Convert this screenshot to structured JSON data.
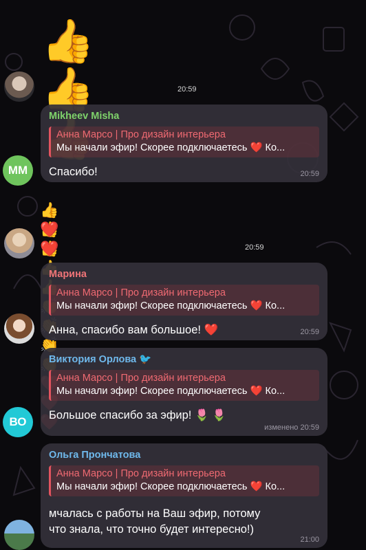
{
  "messages": [
    {
      "type": "emoji",
      "emoji": "👍👍👍",
      "time": "20:59"
    },
    {
      "sender": "Mikheev Misha",
      "avatar_initials": "MM",
      "sender_color": "#7fd36b",
      "avatar_color": "#6fc45d",
      "reply_title": "Анна Марсо | Про дизайн интерьера",
      "reply_text": "Мы начали эфир! Скорее подключаетесь ❤️ Ко...",
      "text": "Спасибо!",
      "time": "20:59"
    },
    {
      "type": "emoji",
      "emoji_line1": "👍👍👍👍👍👏👏👏👏❤️❤️❤️",
      "emoji_line2": "❤️❤️",
      "time": "20:59"
    },
    {
      "sender": "Марина",
      "sender_color": "#f07478",
      "reply_title": "Анна Марсо | Про дизайн интерьера",
      "reply_text": "Мы начали эфир! Скорее подключаетесь ❤️ Ко...",
      "text": "Анна, спасибо вам большое! ❤️",
      "time": "20:59"
    },
    {
      "sender": "Виктория Орлова 🐦",
      "avatar_initials": "ВО",
      "sender_color": "#6fb9ec",
      "avatar_color": "#22c9d6",
      "reply_title": "Анна Марсо | Про дизайн интерьера",
      "reply_text": "Мы начали эфир! Скорее подключаетесь ❤️ Ко...",
      "text": "Большое спасибо за эфир! 🌷 🌷",
      "time": "изменено 20:59"
    },
    {
      "sender": "Ольга Прончатова",
      "sender_color": "#6fb9ec",
      "reply_title": "Анна Марсо | Про дизайн интерьера",
      "reply_text": "Мы начали эфир! Скорее подключаетесь ❤️ Ко...",
      "text_line1": "мчалась с работы на Ваш эфир, потому",
      "text_line2": "что знала, что точно будет интересно!)",
      "time": "21:00"
    }
  ]
}
